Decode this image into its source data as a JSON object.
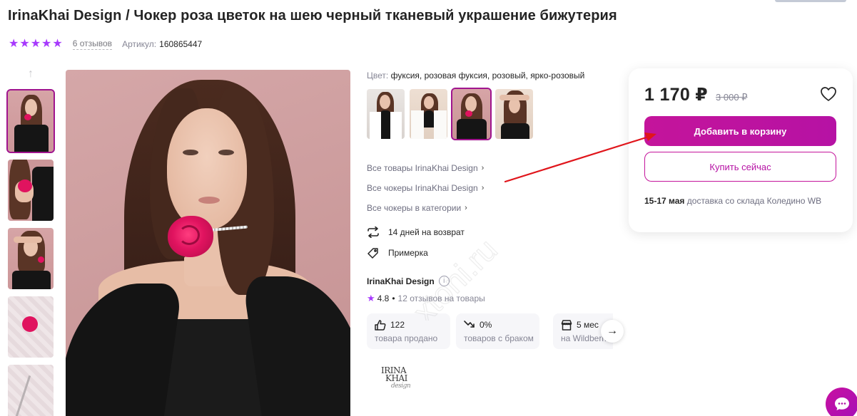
{
  "product": {
    "title": "IrinaKhai Design / Чокер роза цветок на шею черный тканевый украшение бижутерия",
    "rating_stars": 5,
    "reviews_link": "6 отзывов",
    "article_label": "Артикул:",
    "article_value": "160865447"
  },
  "gallery": {
    "thumbs_count": 5,
    "active_index": 0,
    "up_arrow_icon": "arrow-up-icon"
  },
  "color": {
    "label": "Цвет:",
    "value": "фуксия, розовая фуксия, розовый, ярко-розовый",
    "swatches_count": 4,
    "active_index": 2
  },
  "links": [
    {
      "label": "Все товары IrinaKhai Design"
    },
    {
      "label": "Все чокеры IrinaKhai Design"
    },
    {
      "label": "Все чокеры в категории"
    }
  ],
  "features": {
    "return": "14 дней на возврат",
    "fitting": "Примерка"
  },
  "seller": {
    "name": "IrinaKhai Design",
    "rating": "4.8",
    "reviews": "12 отзывов на товары",
    "stats": [
      {
        "value": "122",
        "label": "товара продано",
        "icon": "thumbs-up-icon"
      },
      {
        "value": "0%",
        "label": "товаров с браком",
        "icon": "trend-down-icon"
      },
      {
        "value": "5 мес",
        "label": "на Wildberries",
        "icon": "store-icon"
      }
    ],
    "logo_lines": [
      "IRINA",
      "KHAI",
      "design"
    ]
  },
  "purchase": {
    "price": "1 170 ₽",
    "old_price": "3 000 ₽",
    "add_to_cart": "Добавить в корзину",
    "buy_now": "Купить сейчас",
    "delivery_date": "15-17 мая",
    "delivery_text": "доставка со склада Коледино WB"
  },
  "colors": {
    "accent": "#c4149b",
    "star": "#a73afd",
    "annotation_arrow": "#e0151b"
  },
  "watermark": "xtoni.ru"
}
